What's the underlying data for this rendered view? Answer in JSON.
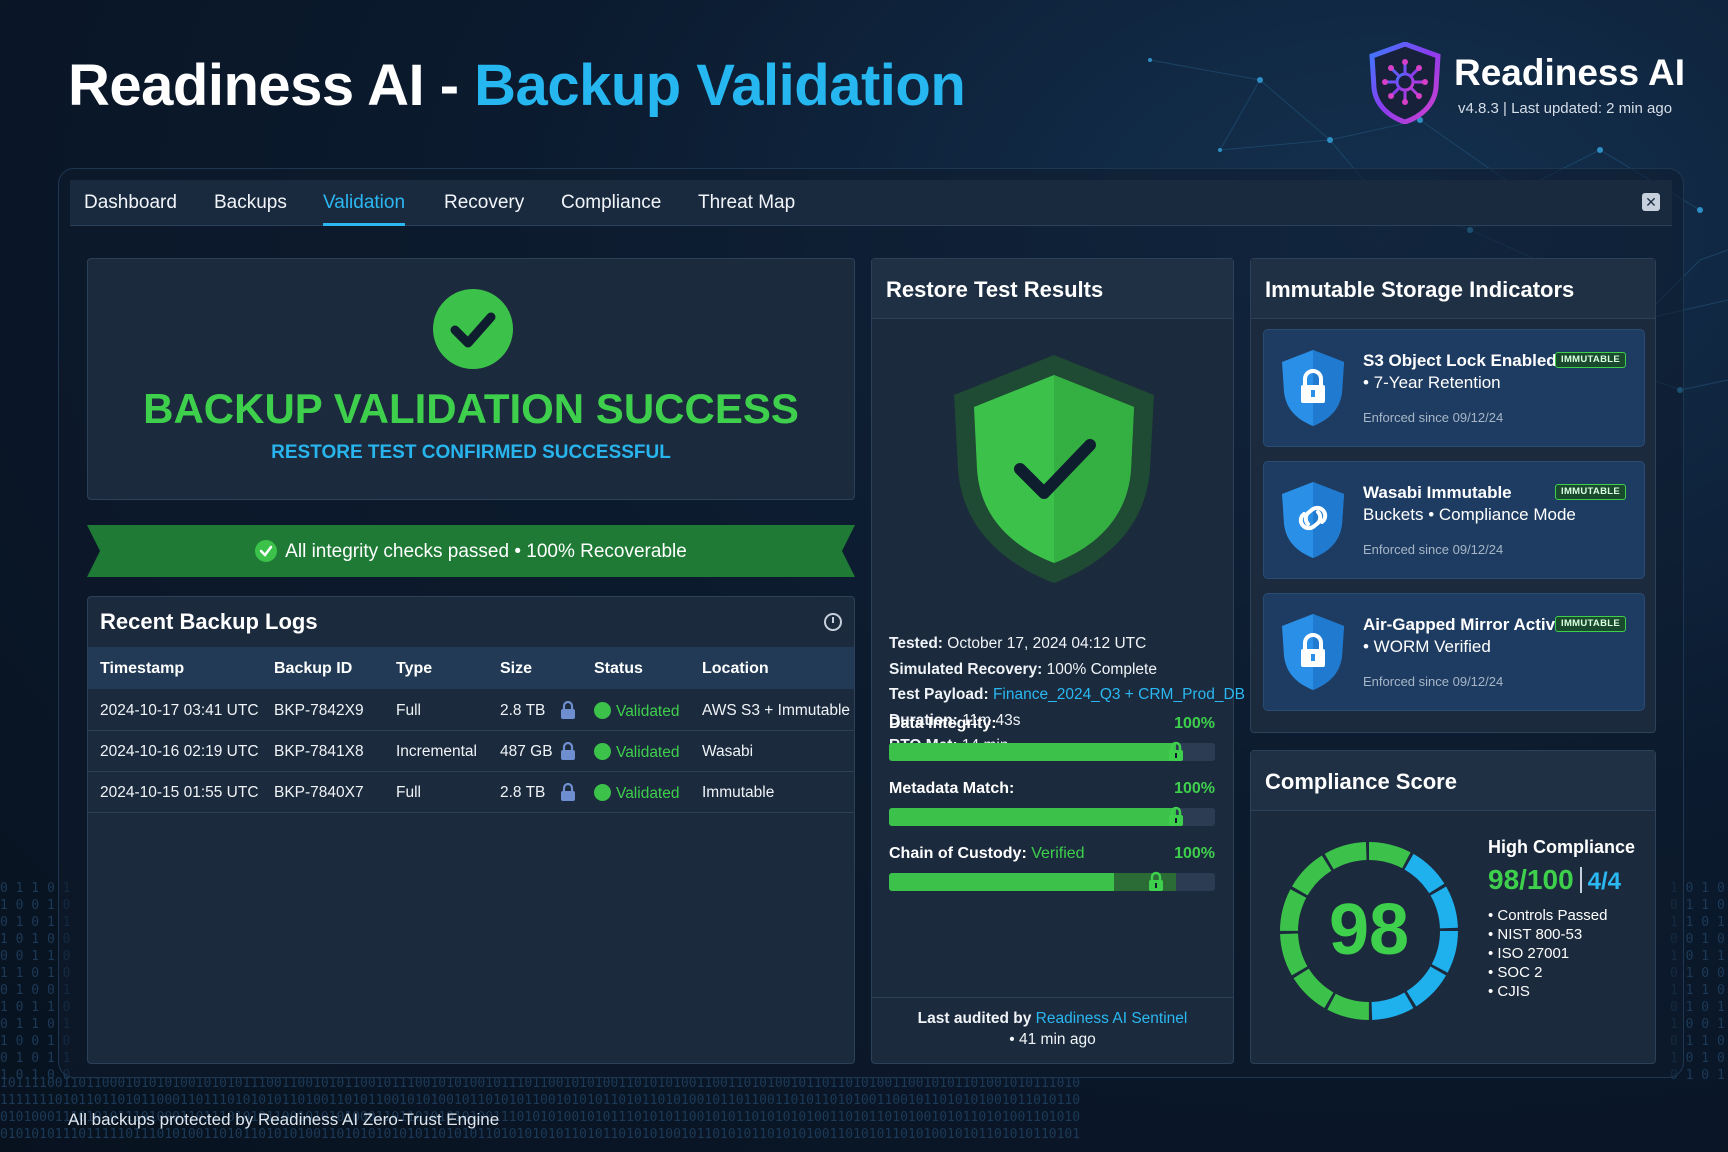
{
  "header": {
    "title_main": "Readiness AI -",
    "title_accent": "Backup Validation",
    "brand_name": "Readiness AI",
    "brand_meta": "v4.8.3 | Last updated: 2 min ago"
  },
  "tabs": [
    {
      "label": "Dashboard"
    },
    {
      "label": "Backups"
    },
    {
      "label": "Validation",
      "active": true
    },
    {
      "label": "Recovery"
    },
    {
      "label": "Compliance"
    },
    {
      "label": "Threat Map"
    }
  ],
  "hero": {
    "title": "BACKUP VALIDATION SUCCESS",
    "subtitle": "RESTORE TEST CONFIRMED SUCCESSFUL"
  },
  "banner": {
    "text": "All integrity checks passed • 100% Recoverable"
  },
  "logs": {
    "title": "Recent Backup Logs",
    "columns": [
      "Timestamp",
      "Backup ID",
      "Type",
      "Size",
      "Status",
      "Location"
    ],
    "rows": [
      {
        "timestamp": "2024-10-17 03:41 UTC",
        "id": "BKP-7842X9",
        "type": "Full",
        "size": "2.8 TB",
        "status": "Validated",
        "location": "AWS S3 + Immutable"
      },
      {
        "timestamp": "2024-10-16 02:19 UTC",
        "id": "BKP-7841X8",
        "type": "Incremental",
        "size": "487 GB",
        "status": "Validated",
        "location": "Wasabi"
      },
      {
        "timestamp": "2024-10-15 01:55 UTC",
        "id": "BKP-7840X7",
        "type": "Full",
        "size": "2.8 TB",
        "status": "Validated",
        "location": "Immutable"
      }
    ]
  },
  "restore": {
    "title": "Restore Test Results",
    "tested_label": "Tested:",
    "tested_value": "October 17, 2024 04:12 UTC",
    "sim_label": "Simulated Recovery:",
    "sim_value": "100% Complete",
    "payload_label": "Test Payload:",
    "payload_value": "Finance_2024_Q3 + CRM_Prod_DB",
    "duration_label": "Duration:",
    "duration_value": "11m 43s",
    "rto_label": "RTO Met:",
    "rto_value": "14 min",
    "bars": [
      {
        "label": "Data Integrity:",
        "extra": "",
        "pct_text": "100%",
        "fill": 0.88
      },
      {
        "label": "Metadata Match:",
        "extra": "",
        "pct_text": "100%",
        "fill": 0.88
      },
      {
        "label": "Chain of Custody:",
        "extra": "Verified",
        "pct_text": "100%",
        "fill": 0.69
      }
    ],
    "audit_prefix": "Last audited by",
    "audit_agent": "Readiness AI Sentinel",
    "audit_time": "• 41 min ago"
  },
  "immutable": {
    "title": "Immutable Storage Indicators",
    "badge": "IMMUTABLE",
    "cards": [
      {
        "title": "S3 Object Lock Enabled",
        "detail": "• 7-Year Retention",
        "since": "Enforced since 09/12/24",
        "icon": "lock-shield-icon"
      },
      {
        "title": "Wasabi Immutable",
        "detail": "Buckets • Compliance Mode",
        "since": "Enforced since 09/12/24",
        "icon": "chain-shield-icon"
      },
      {
        "title": "Air-Gapped Mirror Active",
        "detail": "• WORM Verified",
        "since": "Enforced since 09/12/24",
        "icon": "lock-shield-icon"
      }
    ]
  },
  "compliance": {
    "title": "Compliance Score",
    "score": "98",
    "level": "High Compliance",
    "score_text": "98/100",
    "fraction": "4/4",
    "items": [
      "Controls Passed",
      "NIST 800-53",
      "ISO 27001",
      "SOC 2",
      "CJIS"
    ],
    "score_fraction": 0.98
  },
  "footer": {
    "text": "All backups protected by Readiness AI Zero-Trust Engine"
  },
  "colors": {
    "accent": "#27b7f0",
    "success": "#3ed04c",
    "panel": "#1b2a3c",
    "background": "#0b1a2e"
  }
}
